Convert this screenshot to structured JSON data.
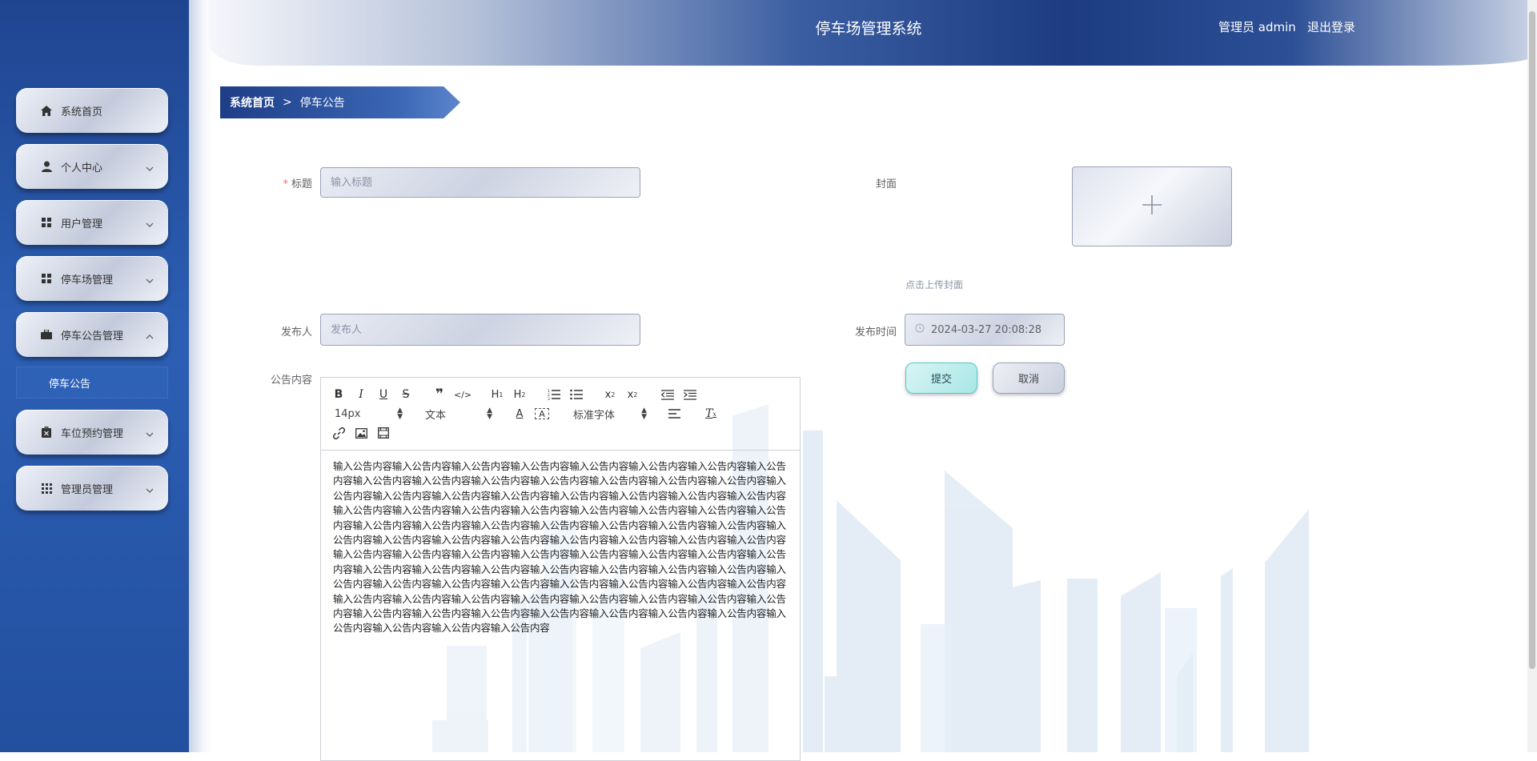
{
  "app": {
    "title": "停车场管理系统",
    "user": "管理员 admin",
    "logout": "退出登录"
  },
  "sidebar": {
    "items": [
      {
        "label": "系统首页",
        "icon": "home-icon"
      },
      {
        "label": "个人中心",
        "icon": "user-icon"
      },
      {
        "label": "用户管理",
        "icon": "grid-icon"
      },
      {
        "label": "停车场管理",
        "icon": "grid-icon"
      },
      {
        "label": "停车公告管理",
        "icon": "briefcase-icon",
        "expanded": true
      },
      {
        "label": "车位预约管理",
        "icon": "clipboard-icon"
      },
      {
        "label": "管理员管理",
        "icon": "apps-icon"
      }
    ],
    "submenu": {
      "label": "停车公告"
    }
  },
  "breadcrumb": {
    "home": "系统首页",
    "separator": ">",
    "current": "停车公告"
  },
  "form": {
    "title_label": "标题",
    "title_required": "*",
    "title_placeholder": "输入标题",
    "cover_label": "封面",
    "cover_hint": "点击上传封面",
    "publisher_label": "发布人",
    "publisher_placeholder": "发布人",
    "time_label": "发布时间",
    "time_value": "2024-03-27 20:08:28",
    "content_label": "公告内容",
    "submit": "提交",
    "cancel": "取消"
  },
  "editor": {
    "font_size": "14px",
    "text_type": "文本",
    "font_family": "标准字体",
    "content": "输入公告内容输入公告内容输入公告内容输入公告内容输入公告内容输入公告内容输入公告内容输入公告内容输入公告内容输入公告内容输入公告内容输入公告内容输入公告内容输入公告内容输入公告内容输入公告内容输入公告内容输入公告内容输入公告内容输入公告内容输入公告内容输入公告内容输入公告内容输入公告内容输入公告内容输入公告内容输入公告内容输入公告内容输入公告内容输入公告内容输入公告内容输入公告内容输入公告内容输入公告内容输入公告内容输入公告内容输入公告内容输入公告内容输入公告内容输入公告内容输入公告内容输入公告内容输入公告内容输入公告内容输入公告内容输入公告内容输入公告内容输入公告内容输入公告内容输入公告内容输入公告内容输入公告内容输入公告内容输入公告内容输入公告内容输入公告内容输入公告内容输入公告内容输入公告内容输入公告内容输入公告内容输入公告内容输入公告内容输入公告内容输入公告内容输入公告内容输入公告内容输入公告内容输入公告内容输入公告内容输入公告内容输入公告内容输入公告内容输入公告内容输入公告内容输入公告内容输入公告内容输入公告内容输入公告内容输入公告内容输入公告内容输入公告内容输入公告内容输入公告内容输入公告内容输入公告内容输入公告内容输入公告内容"
  },
  "colors": {
    "sidebar": "#2c5fb4",
    "header_dark": "#1d3c82",
    "submit_accent": "#58c9c9",
    "required": "#f56c6c"
  }
}
